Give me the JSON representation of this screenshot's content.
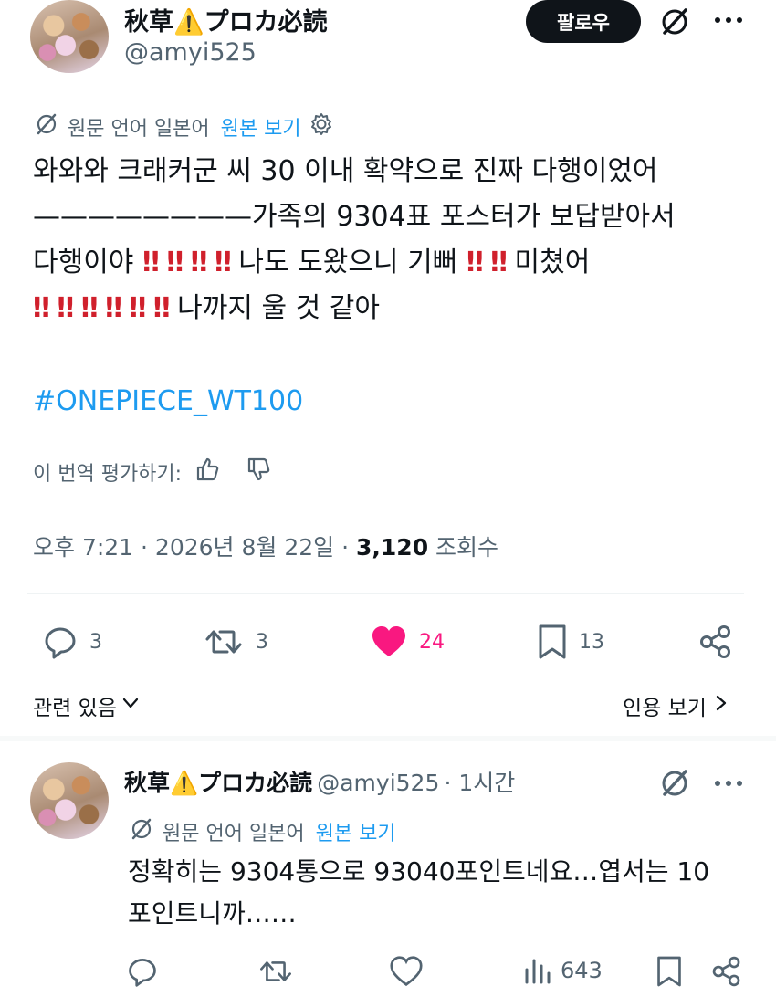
{
  "post": {
    "display_name": "秋草⚠️プロカ必読",
    "handle": "@amyi525",
    "follow_label": "팔로우",
    "translated_label": "원문 언어 일본어",
    "view_original": "원본 보기",
    "line1": "와와와 크래커군 씨 30 이내 확약으로 진짜 다행이었어",
    "line2": "————————가족의 9304표 포스터가 보답받아서",
    "line3_a": "다행이야",
    "line3_b": "나도 도왔으니 기뻐",
    "line3_c": "미쳤어",
    "line4": "나까지 울 것 같아",
    "bang": "‼",
    "hashtag": "#ONEPIECE_WT100",
    "rate_label": "이 번역 평가하기:",
    "time": "오후 7:21 · 2026년 8월 22일 ·",
    "views_count": "3,120",
    "views_label": "조회수",
    "replies": "3",
    "reposts": "3",
    "likes": "24",
    "bookmarks": "13",
    "related_label": "관련 있음",
    "quotes_label": "인용 보기"
  },
  "reply": {
    "display_name": "秋草⚠️プロカ必読",
    "handle": "@amyi525",
    "time": "· 1시간",
    "translated_label": "원문 언어 일본어",
    "view_original": "원본 보기",
    "line1": "정확히는 9304통으로 93040포인트네요…엽서는 10",
    "line2": "포인트니까……",
    "views": "643"
  },
  "colors": {
    "accent": "#1d9bf0",
    "like": "#f91880",
    "bang": "#d0202c",
    "text": "#0f1419",
    "muted": "#536471"
  }
}
